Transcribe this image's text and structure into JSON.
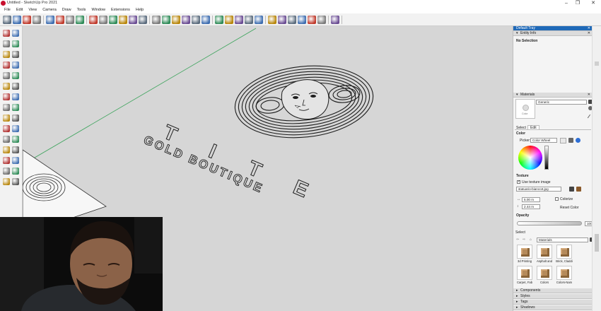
{
  "window": {
    "title": "Untitled - SketchUp Pro 2021"
  },
  "menu": [
    "File",
    "Edit",
    "View",
    "Camera",
    "Draw",
    "Tools",
    "Window",
    "Extensions",
    "Help"
  ],
  "toolbar": {
    "groups": [
      [
        "select-icon",
        "eraser-icon",
        "paint-bucket-icon",
        "orbit-icon"
      ],
      [
        "line-icon",
        "arc-icon",
        "rectangle-icon",
        "circle-icon"
      ],
      [
        "push-pull-icon",
        "move-icon",
        "rotate-icon",
        "scale-icon",
        "offset-icon",
        "follow-me-icon"
      ],
      [
        "tape-measure-icon",
        "dimension-icon",
        "protractor-icon",
        "text-icon",
        "axes-icon",
        "3d-text-icon"
      ],
      [
        "warehouse-icon",
        "extension-icon",
        "sandbox-icon",
        "section-icon",
        "solid-icon"
      ],
      [
        "iso-view-icon",
        "top-view-icon",
        "front-view-icon",
        "right-view-icon",
        "back-view-icon",
        "left-view-icon"
      ],
      [
        "style-icon"
      ]
    ]
  },
  "viewport": {
    "logo_line1": "T I T E",
    "logo_line2": "GOLD BOUTIQUE"
  },
  "tray": {
    "title": "Default Tray",
    "entity_info": {
      "header": "Entity Info",
      "status": "No Selection"
    },
    "materials": {
      "header": "Materials",
      "name": "Generic",
      "preview_label": "Color",
      "tab_select": "Select",
      "tab_edit": "Edit",
      "color_label": "Color",
      "picker_label": "Picker:",
      "picker_value": "Color Wheel",
      "texture_label": "Texture",
      "use_texture_label": "Use texture image",
      "texture_file": "statuario-bianco3.jpg",
      "width_value": "5.00 m",
      "height_value": "2.44 m",
      "colorize_label": "Colorize",
      "reset_label": "Reset Color",
      "opacity_label": "Opacity",
      "opacity_value": "100",
      "select_label": "Select",
      "library": "Materials",
      "items": [
        "3d Printing",
        "Asphalt and",
        "Brick, Claddi",
        "Carpet, Fab",
        "Colors",
        "Colors-Nam"
      ]
    },
    "collapsed": [
      "Components",
      "Styles",
      "Tags",
      "Shadows"
    ]
  }
}
